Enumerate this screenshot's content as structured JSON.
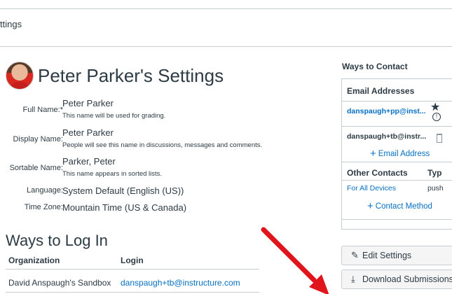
{
  "breadcrumb": "ttings",
  "profile": {
    "title": "Peter Parker's Settings",
    "fields": [
      {
        "label": "Full Name:*",
        "value": "Peter Parker",
        "hint": "This name will be used for grading."
      },
      {
        "label": "Display Name:",
        "value": "Peter Parker",
        "hint": "People will see this name in discussions, messages and comments."
      },
      {
        "label": "Sortable Name:",
        "value": "Parker, Peter",
        "hint": "This name appears in sorted lists."
      },
      {
        "label": "Language:",
        "value": "System Default (English (US))",
        "hint": ""
      },
      {
        "label": "Time Zone:",
        "value": "Mountain Time (US & Canada)",
        "hint": ""
      }
    ]
  },
  "logins": {
    "title": "Ways to Log In",
    "headers": [
      "Organization",
      "Login"
    ],
    "rows": [
      {
        "organization": "David Anspaugh's Sandbox",
        "login": "danspaugh+tb@instructure.com"
      }
    ]
  },
  "contact": {
    "title": "Ways to Contact",
    "email_header": "Email Addresses",
    "emails": [
      "danspaugh+pp@inst...",
      "danspaugh+tb@instr..."
    ],
    "add_email": "Email Address",
    "other_header": "Other Contacts",
    "type_header": "Typ",
    "other_rows": [
      {
        "name": "For All Devices",
        "type": "push"
      }
    ],
    "add_contact": "Contact Method"
  },
  "actions": {
    "edit_settings": "Edit Settings",
    "download_submissions": "Download Submissions"
  },
  "icons": {
    "avatar": "profile-avatar",
    "star": "star-icon",
    "info": "info-icon",
    "trash": "trash-icon",
    "pencil": "pencil-icon",
    "download": "download-icon",
    "plus": "plus-icon",
    "arrow": "annotation-arrow"
  },
  "colors": {
    "link": "#0770c2",
    "text": "#2d3b45",
    "border": "#c7cdd1",
    "arrow": "#e0141b"
  }
}
